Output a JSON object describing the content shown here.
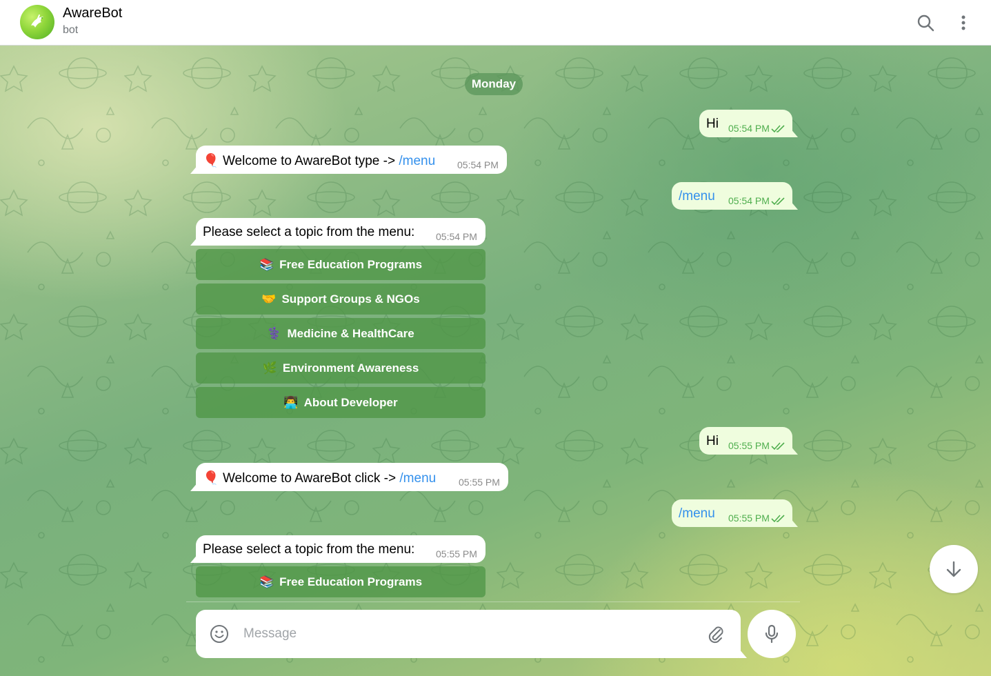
{
  "header": {
    "title": "AwareBot",
    "subtitle": "bot",
    "avatar_icon": "dove-icon",
    "search_icon": "search-icon",
    "more_icon": "more-vertical-icon"
  },
  "chat": {
    "date_label": "Monday",
    "messages": [
      {
        "dir": "out",
        "text": "Hi",
        "time": "05:54 PM",
        "status": "read"
      },
      {
        "dir": "in",
        "emoji": "🎈",
        "text": "Welcome to AwareBot type -> ",
        "link": "/menu",
        "time": "05:54 PM"
      },
      {
        "dir": "out",
        "link": "/menu",
        "time": "05:54 PM",
        "status": "read"
      },
      {
        "dir": "in",
        "text": "Please select a topic from the menu:",
        "time": "05:54 PM",
        "keyboard": [
          {
            "emoji": "📚",
            "label": "Free Education Programs"
          },
          {
            "emoji": "🤝",
            "label": "Support Groups & NGOs"
          },
          {
            "emoji": "⚕️",
            "label": "Medicine & HealthCare"
          },
          {
            "emoji": "🌿",
            "label": "Environment Awareness"
          },
          {
            "emoji": "👨‍💻",
            "label": "About Developer"
          }
        ]
      },
      {
        "dir": "out",
        "text": "Hi",
        "time": "05:55 PM",
        "status": "read"
      },
      {
        "dir": "in",
        "emoji": "🎈",
        "text": "Welcome to AwareBot click -> ",
        "link": "/menu",
        "time": "05:55 PM"
      },
      {
        "dir": "out",
        "link": "/menu",
        "time": "05:55 PM",
        "status": "read"
      },
      {
        "dir": "in",
        "text": "Please select a topic from the menu:",
        "time": "05:55 PM",
        "keyboard": [
          {
            "emoji": "📚",
            "label": "Free Education Programs"
          }
        ]
      }
    ]
  },
  "composer": {
    "placeholder": "Message",
    "emoji_icon": "smiley-icon",
    "attach_icon": "paperclip-icon",
    "mic_icon": "microphone-icon"
  },
  "scroll_button_icon": "arrow-down-icon",
  "colors": {
    "outgoing_bubble": "#effdde",
    "incoming_bubble": "#ffffff",
    "link": "#3390ec",
    "outgoing_time": "#4fae4e",
    "keyboard_button": "#5a9a50"
  }
}
